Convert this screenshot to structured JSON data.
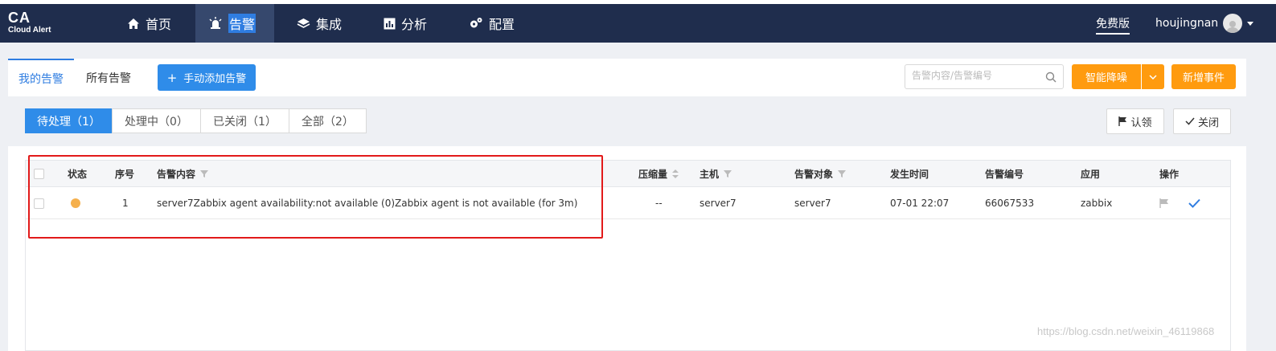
{
  "app": {
    "logo_title": "CA",
    "logo_subtitle": "Cloud Alert",
    "edition": "免费版",
    "username": "houjingnan"
  },
  "nav": {
    "items": [
      {
        "label": "首页",
        "icon": "home-icon"
      },
      {
        "label": "告警",
        "icon": "alarm-icon",
        "active": true
      },
      {
        "label": "集成",
        "icon": "layers-icon"
      },
      {
        "label": "分析",
        "icon": "chart-icon"
      },
      {
        "label": "配置",
        "icon": "gear-icon"
      }
    ]
  },
  "tabs": {
    "mine": "我的告警",
    "all": "所有告警",
    "add_button": "手动添加告警"
  },
  "search": {
    "placeholder": "告警内容/告警编号"
  },
  "actions": {
    "smart_denoise": "智能降噪",
    "new_incident": "新增事件",
    "claim": "认领",
    "close": "关闭"
  },
  "filters": [
    {
      "label": "待处理（1）",
      "active": true
    },
    {
      "label": "处理中（0）"
    },
    {
      "label": "已关闭（1）"
    },
    {
      "label": "全部（2）"
    }
  ],
  "table": {
    "headers": {
      "status": "状态",
      "index": "序号",
      "content": "告警内容",
      "compressed": "压缩量",
      "host": "主机",
      "target": "告警对象",
      "time": "发生时间",
      "alert_id": "告警编号",
      "app": "应用",
      "ops": "操作"
    },
    "rows": [
      {
        "status_color": "#f5b04d",
        "index": "1",
        "content": "server7Zabbix agent availability:not available (0)Zabbix agent is not available (for 3m)",
        "compressed": "--",
        "host": "server7",
        "target": "server7",
        "time": "07-01 22:07",
        "alert_id": "66067533",
        "app": "zabbix"
      }
    ]
  },
  "watermark": "https://blog.csdn.net/weixin_46119868",
  "colors": {
    "topbar": "#1f2d4d",
    "primary": "#2f8ce9",
    "orange": "#ff9b0f",
    "highlight_box": "#e21a1a"
  }
}
